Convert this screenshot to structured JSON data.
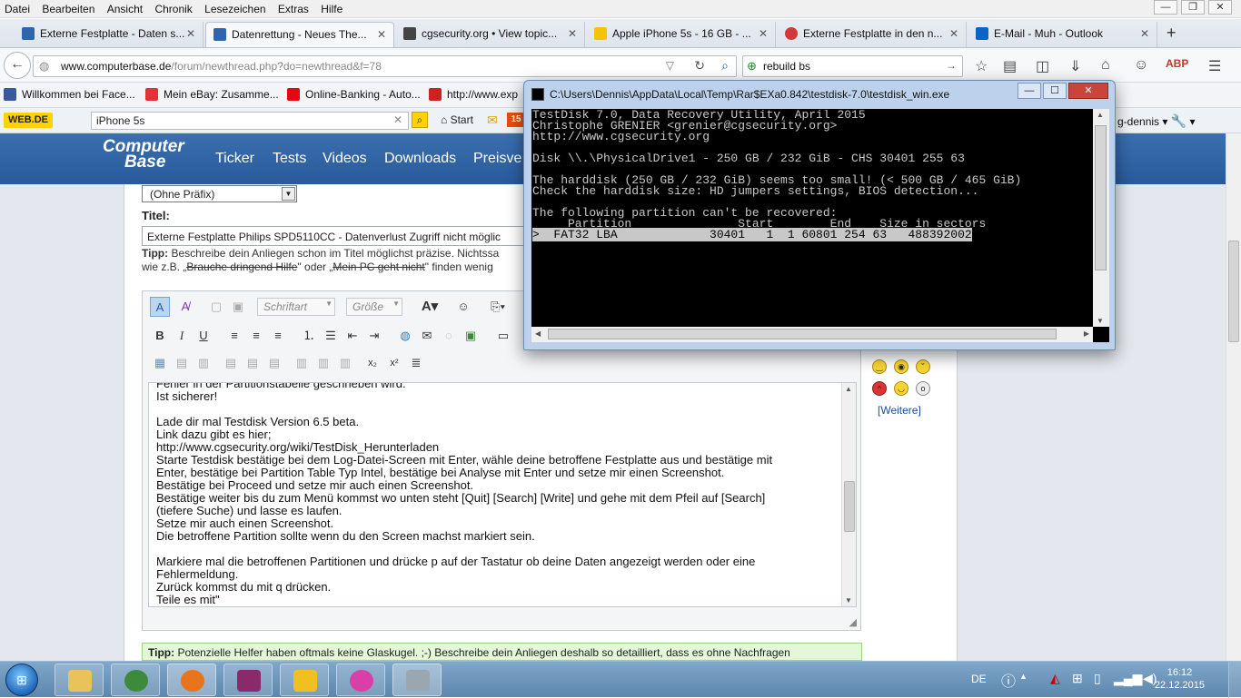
{
  "menu": [
    "Datei",
    "Bearbeiten",
    "Ansicht",
    "Chronik",
    "Lesezeichen",
    "Extras",
    "Hilfe"
  ],
  "tabs": [
    {
      "label": "Externe Festplatte - Daten s...",
      "color": "#2e64b0"
    },
    {
      "label": "Datenrettung - Neues The...",
      "color": "#2e64b0"
    },
    {
      "label": "cgsecurity.org • View topic...",
      "color": "#444444"
    },
    {
      "label": "Apple iPhone 5s - 16 GB - ...",
      "color": "#f5c400"
    },
    {
      "label": "Externe Festplatte in den n...",
      "color": "#d23a3a"
    },
    {
      "label": "E-Mail - Muh - Outlook",
      "color": "#0a64c8"
    }
  ],
  "new_tab": "+",
  "url": {
    "host": "www.computerbase.de",
    "path": "/forum/newthread.php?do=newthread&f=78"
  },
  "search": {
    "value": "rebuild bs"
  },
  "bookmarks": [
    {
      "label": "Willkommen bei Face...",
      "color": "#3b5998"
    },
    {
      "label": "Mein eBay: Zusamme...",
      "color": "#e53238"
    },
    {
      "label": "Online-Banking - Auto...",
      "color": "#e30613"
    },
    {
      "label": "http://www.exp",
      "color": "#cc2222"
    }
  ],
  "webde": {
    "logo": "WEB.DE",
    "search_value": "iPhone 5s",
    "start_label": "Start",
    "mail_badge": "15",
    "user": "g-dennis"
  },
  "site": {
    "logo_line1": "Computer",
    "logo_line2": "Base",
    "nav": [
      "Ticker",
      "Tests",
      "Videos",
      "Downloads",
      "Preisve"
    ]
  },
  "form": {
    "prefix": "(Ohne Präfix)",
    "title_label": "Titel:",
    "title_value": "Externe Festplatte Philips SPD5110CC - Datenverlust Zugriff nicht möglic",
    "tip1_bold": "Tipp:",
    "tip1_text": " Beschreibe dein Anliegen schon im Titel möglichst präzise. Nichtssa",
    "tip1_line2_pre": "wie z.B. „",
    "tip1_strike1": "Brauche dringend Hilfe",
    "tip1_mid": "\" oder „",
    "tip1_strike2": "Mein PC geht nicht",
    "tip1_post": "\" finden wenig",
    "font_select": "Schriftart",
    "size_select": "Größe",
    "body_lines": [
      "Fehler in der Partitionstabelle geschrieben wird.",
      "Ist sicherer!",
      "",
      "Lade dir mal Testdisk Version 6.5 beta.",
      "Link dazu gibt es hier;",
      "http://www.cgsecurity.org/wiki/TestDisk_Herunterladen",
      "Starte Testdisk bestätige bei dem Log-Datei-Screen mit Enter, wähle deine betroffene Festplatte aus und bestätige mit",
      "Enter, bestätige bei Partition Table Typ Intel, bestätige bei Analyse mit Enter und setze mir einen Screenshot.",
      "Bestätige bei Proceed und setze mir auch einen Screenshot.",
      "Bestätige weiter bis du zum Menü kommst wo unten steht [Quit] [Search] [Write] und gehe mit dem Pfeil auf [Search]",
      "(tiefere Suche) und lasse es laufen.",
      "Setze mir auch einen Screenshot.",
      "Die betroffene Partition sollte wenn du den Screen machst markiert sein.",
      "",
      "Markiere mal die betroffenen Partitionen und drücke p auf der Tastatur ob deine Daten angezeigt werden oder eine",
      "Fehlermeldung.",
      "Zurück kommst du mit q drücken.",
      "Teile es mit\""
    ],
    "more_smilies": "[Weitere]",
    "tip2_bold": "Tipp:",
    "tip2_text": " Potenzielle Helfer haben oftmals keine Glaskugel. ;-) Beschreibe dein Anliegen deshalb so detailliert, dass es ohne Nachfragen"
  },
  "console": {
    "title": "C:\\Users\\Dennis\\AppData\\Local\\Temp\\Rar$EXa0.842\\testdisk-7.0\\testdisk_win.exe",
    "lines": [
      "TestDisk 7.0, Data Recovery Utility, April 2015",
      "Christophe GRENIER <grenier@cgsecurity.org>",
      "http://www.cgsecurity.org",
      "",
      "Disk \\\\.\\PhysicalDrive1 - 250 GB / 232 GiB - CHS 30401 255 63",
      "",
      "The harddisk (250 GB / 232 GiB) seems too small! (< 500 GB / 465 GiB)",
      "Check the harddisk size: HD jumpers settings, BIOS detection...",
      "",
      "The following partition can't be recovered:",
      "     Partition               Start        End    Size in sectors"
    ],
    "highlight_line": ">  FAT32 LBA             30401   1  1 60801 254 63   488392002"
  },
  "taskbar": {
    "lang": "DE",
    "time": "16:12",
    "date": "22.12.2015",
    "apps": [
      {
        "name": "explorer",
        "color": "#e8c35a"
      },
      {
        "name": "network",
        "color": "#3d8a3a"
      },
      {
        "name": "firefox",
        "color": "#e8741c"
      },
      {
        "name": "winrar",
        "color": "#8a2a6a"
      },
      {
        "name": "totalcmd",
        "color": "#f0c020"
      },
      {
        "name": "itunes",
        "color": "#d840a8"
      },
      {
        "name": "testdisk",
        "color": "#9aa6b0"
      }
    ]
  }
}
